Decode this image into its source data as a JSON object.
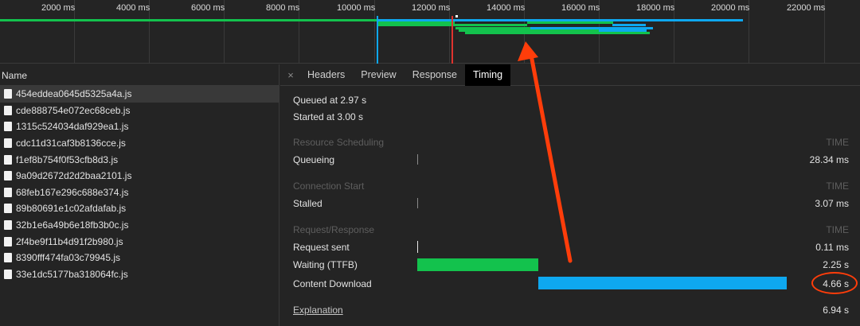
{
  "overview": {
    "ticks": [
      "2000 ms",
      "4000 ms",
      "6000 ms",
      "8000 ms",
      "10000 ms",
      "12000 ms",
      "14000 ms",
      "16000 ms",
      "18000 ms",
      "20000 ms",
      "22000 ms"
    ]
  },
  "list": {
    "header": "Name",
    "items": [
      "454eddea0645d5325a4a.js",
      "cde888754e072ec68ceb.js",
      "1315c524034daf929ea1.js",
      "cdc11d31caf3b8136cce.js",
      "f1ef8b754f0f53cfb8d3.js",
      "9a09d2672d2d2baa2101.js",
      "68feb167e296c688e374.js",
      "89b80691e1c02afdafab.js",
      "32b1e6a49b6e18fb3b0c.js",
      "2f4be9f11b4d91f2b980.js",
      "8390fff474fa03c79945.js",
      "33e1dc5177ba318064fc.js"
    ],
    "selected_index": 0
  },
  "tabs": {
    "close": "×",
    "items": [
      "Headers",
      "Preview",
      "Response",
      "Timing"
    ],
    "active": "Timing"
  },
  "timing": {
    "queued": "Queued at 2.97 s",
    "started": "Started at 3.00 s",
    "time_label": "TIME",
    "sections": {
      "resource_scheduling": "Resource Scheduling",
      "connection_start": "Connection Start",
      "request_response": "Request/Response"
    },
    "rows": {
      "queueing": {
        "label": "Queueing",
        "value": "28.34 ms"
      },
      "stalled": {
        "label": "Stalled",
        "value": "3.07 ms"
      },
      "request_sent": {
        "label": "Request sent",
        "value": "0.11 ms"
      },
      "waiting": {
        "label": "Waiting (TTFB)",
        "value": "2.25 s"
      },
      "content_download": {
        "label": "Content Download",
        "value": "4.66 s"
      }
    },
    "explanation": "Explanation",
    "total": "6.94 s"
  },
  "colors": {
    "waiting_bar": "#13c24d",
    "download_bar": "#0ea8f0",
    "annotation": "#ff3d0a"
  }
}
